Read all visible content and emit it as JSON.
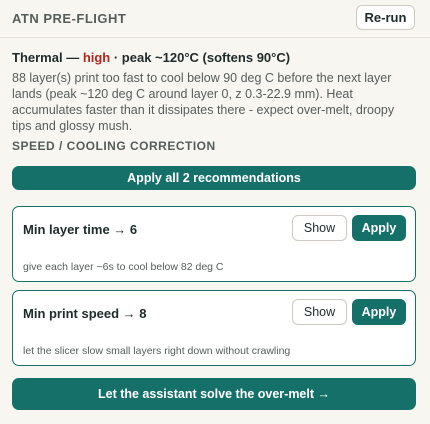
{
  "header": {
    "title": "ATN PRE-FLIGHT",
    "rerun_label": "Re-run"
  },
  "finding": {
    "category": "Thermal",
    "separator": " — ",
    "severity": "high",
    "detail": " · peak ~120°C (softens 90°C)",
    "body": "88 layer(s) print too fast to cool below 90 deg C before the next layer lands (peak ~120 deg C around layer 0, z 0.3-22.9 mm). Heat accumulates faster than it dissipates there - expect over-melt, droopy tips and glossy mush."
  },
  "section": {
    "label": "SPEED / COOLING CORRECTION",
    "apply_all_label": "Apply all 2 recommendations"
  },
  "recommendations": [
    {
      "title": "Min layer time → 6",
      "show_label": "Show",
      "apply_label": "Apply",
      "description": "give each layer ~6s to cool below 82 deg C"
    },
    {
      "title": "Min print speed → 8",
      "show_label": "Show",
      "apply_label": "Apply",
      "description": "let the slicer slow small layers right down without crawling"
    }
  ],
  "assistant": {
    "label": "Let the assistant solve the over-melt →"
  },
  "colors": {
    "accent": "#16706a",
    "severity_high": "#b3261e",
    "background": "#f8f6f1"
  }
}
